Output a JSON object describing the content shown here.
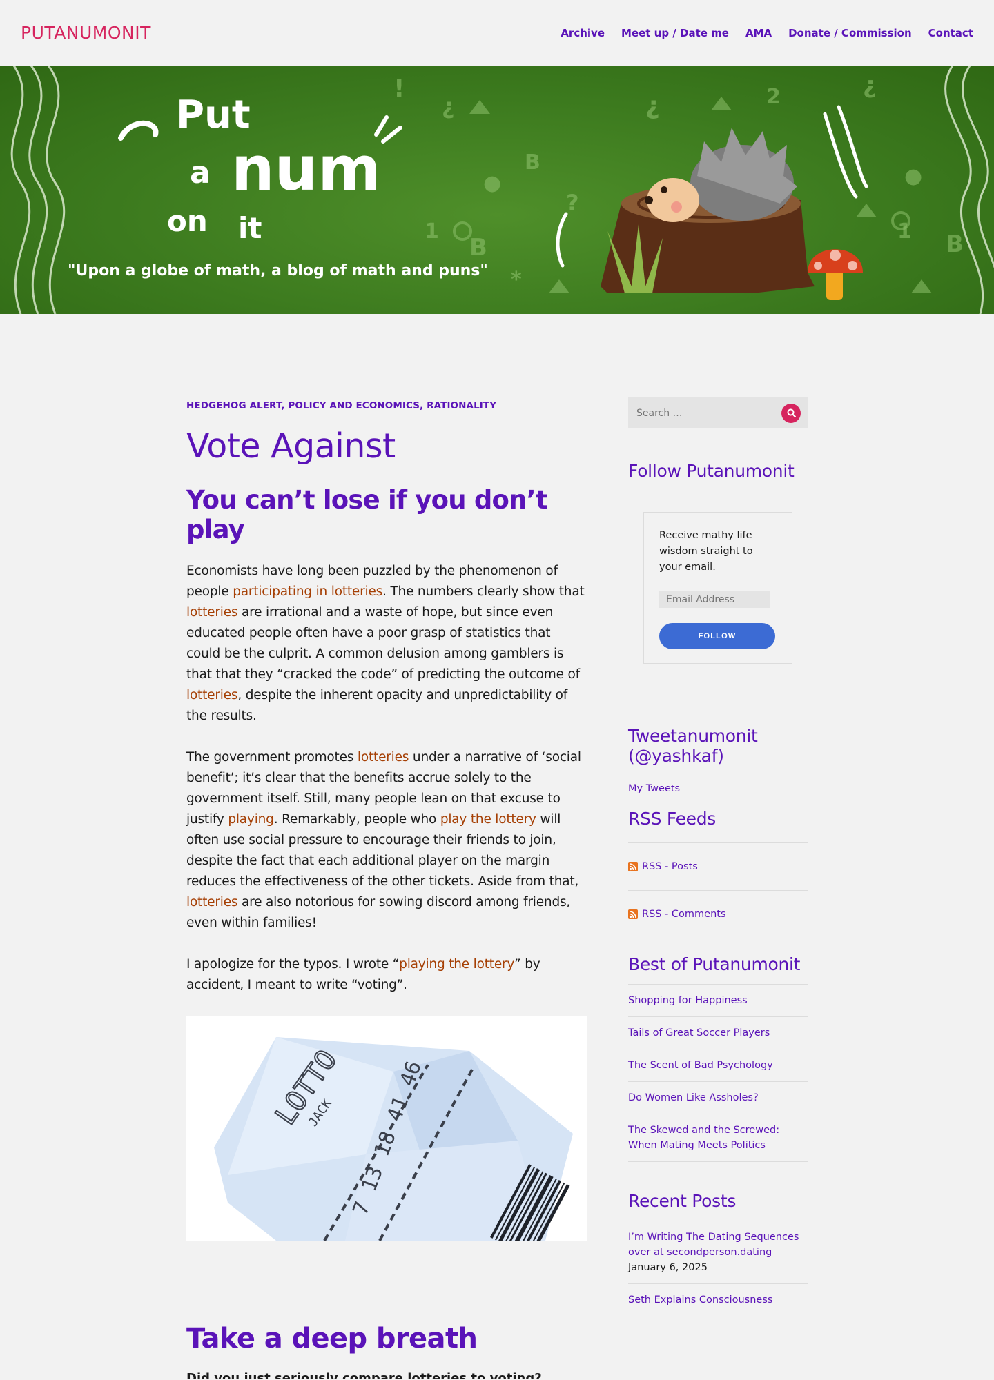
{
  "site": {
    "title": "PUTANUMONIT",
    "nav": [
      "Archive",
      "Meet up / Date me",
      "AMA",
      "Donate / Commission",
      "Contact"
    ]
  },
  "banner": {
    "logo_words": [
      "Put",
      "a",
      "num",
      "on",
      "it"
    ],
    "tagline": "\"Upon a globe of math, a blog of math and puns\""
  },
  "post": {
    "categories": "HEDGEHOG ALERT, POLICY AND ECONOMICS, RATIONALITY",
    "title": "Vote Against",
    "subtitle": "You can’t lose if you don’t play",
    "p1": {
      "t1": "Economists have long been puzzled by the phenomenon of people ",
      "l1": "participating in lotteries",
      "t2": ". The numbers clearly show that ",
      "l2": "lotteries",
      "t3": " are irrational and a waste of hope, but since even educated people often have a poor grasp of statistics that could be the culprit. A common delusion among gamblers is that that they “cracked the code” of predicting the outcome of ",
      "l3": "lotteries",
      "t4": ", despite the inherent opacity and unpredictability of the results."
    },
    "p2": {
      "t1": "The government promotes ",
      "l1": "lotteries",
      "t2": " under a narrative of ‘social benefit’; it’s clear that the benefits accrue solely to the government itself. Still, many people lean on that excuse to justify ",
      "l2": "playing",
      "t3": ". Remarkably, people who ",
      "l3": "play the lottery",
      "t4": " will often use social pressure to encourage their friends to join, despite the fact that each additional player on the margin reduces the effectiveness of the other tickets. Aside from that, ",
      "l4": "lotteries",
      "t5": " are also notorious for sowing discord among friends, even within families!"
    },
    "p3": {
      "t1": "I apologize for the typos. I wrote “",
      "l1": "playing the lottery",
      "t2": "” by accident, I meant to write “voting”."
    },
    "image": {
      "ticket_word": "LOTTO",
      "ticket_sub": "JACK",
      "ticket_numbers": "7 13 18 41 46"
    },
    "next_title": "Take a deep breath",
    "next_teaser": "Did you just seriously compare lotteries to voting?"
  },
  "sidebar": {
    "search_placeholder": "Search …",
    "follow_title": "Follow Putanumonit",
    "follow_text": "Receive mathy life wisdom straight to your email.",
    "email_placeholder": "Email Address",
    "follow_button": "FOLLOW",
    "tweets_title": "Tweetanumonit (@yashkaf)",
    "tweets_link": "My Tweets",
    "rss_title": "RSS Feeds",
    "rss_posts": "RSS - Posts",
    "rss_comments": "RSS - Comments",
    "best_title": "Best of Putanumonit",
    "best": [
      "Shopping for Happiness",
      "Tails of Great Soccer Players",
      "The Scent of Bad Psychology",
      "Do Women Like Assholes?",
      "The Skewed and the Screwed: When Mating Meets Politics"
    ],
    "recent_title": "Recent Posts",
    "recent": [
      {
        "title": "I’m Writing The Dating Sequences over at secondperson.dating",
        "date": "January 6, 2025"
      },
      {
        "title": "Seth Explains Consciousness",
        "date": ""
      }
    ]
  },
  "colors": {
    "accent_purple": "#5a13b8",
    "brand_pink": "#d6245e",
    "link_orange": "#a53f04",
    "button_blue": "#3c6bd4",
    "banner_green": "#3c7a1e"
  }
}
